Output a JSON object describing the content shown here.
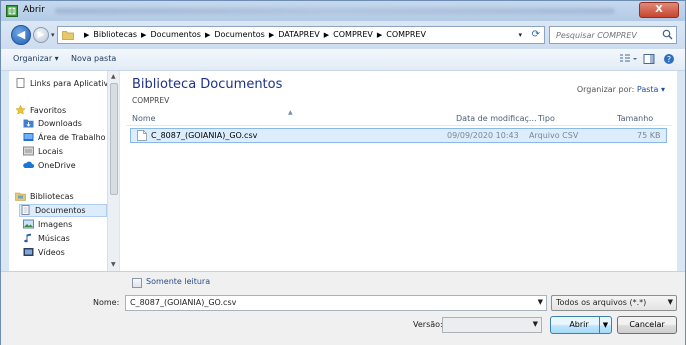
{
  "window": {
    "title": "Abrir",
    "close_label": "X"
  },
  "address": {
    "breadcrumbs": [
      "Bibliotecas",
      "Documentos",
      "Documentos",
      "DATAPREV",
      "COMPREV",
      "COMPREV"
    ]
  },
  "search": {
    "placeholder": "Pesquisar COMPREV"
  },
  "toolbar": {
    "organize_label": "Organizar ▾",
    "new_folder_label": "Nova pasta"
  },
  "nav": {
    "items": [
      {
        "label": "Links para Aplicativos",
        "type": "page"
      },
      {
        "label": "Favoritos",
        "type": "star"
      },
      {
        "label": "Downloads",
        "type": "folder"
      },
      {
        "label": "Área de Trabalho",
        "type": "desktop"
      },
      {
        "label": "Locais",
        "type": "places"
      },
      {
        "label": "OneDrive",
        "type": "cloud"
      },
      {
        "label": "Bibliotecas",
        "type": "library"
      },
      {
        "label": "Documentos",
        "type": "docs"
      },
      {
        "label": "Imagens",
        "type": "images"
      },
      {
        "label": "Músicas",
        "type": "music"
      },
      {
        "label": "Vídeos",
        "type": "video"
      }
    ]
  },
  "library": {
    "title": "Biblioteca Documentos",
    "subtitle": "COMPREV",
    "arrange_label": "Organizar por:",
    "arrange_value": "Pasta ▾"
  },
  "columns": {
    "name": "Nome",
    "date": "Data de modificaç...",
    "type": "Tipo",
    "size": "Tamanho"
  },
  "files": [
    {
      "name": "C_8087_(GOIANIA)_GO.csv",
      "date": "09/09/2020 10:43",
      "type": "Arquivo CSV",
      "size": "75 KB"
    }
  ],
  "bottom": {
    "readonly_label": "Somente leitura",
    "name_label": "Nome:",
    "name_value": "C_8087_(GOIANIA)_GO.csv",
    "filter_value": "Todos os arquivos (*.*)",
    "version_label": "Versão:",
    "open_label": "Abrir",
    "cancel_label": "Cancelar"
  },
  "colors": {
    "title_blue": "#1e3287",
    "selection": "#dceefd",
    "accent": "#3c7fb1"
  }
}
